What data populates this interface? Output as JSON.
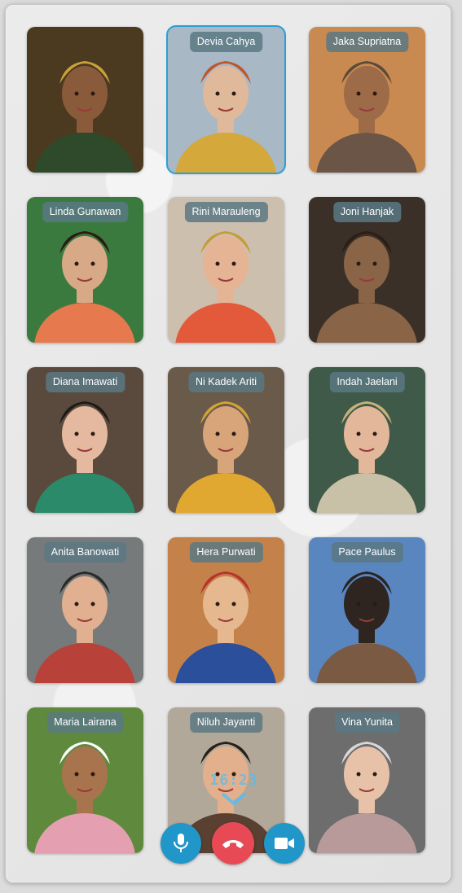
{
  "call": {
    "timer": "16:23",
    "participants": [
      {
        "name": "",
        "active": false,
        "bg": "#4b3a20",
        "skin": "#8a5b3a",
        "hat": "#c9a23a",
        "cloth": "#2e4a2b"
      },
      {
        "name": "Devia Cahya",
        "active": true,
        "bg": "#a8b8c4",
        "skin": "#e0b89a",
        "hat": "#c0552c",
        "cloth": "#d4a83a"
      },
      {
        "name": "Jaka Supriatna",
        "active": false,
        "bg": "#c88a50",
        "skin": "#9d6b48",
        "hat": "#5a4a3a",
        "cloth": "#6a5546"
      },
      {
        "name": "Linda Gunawan",
        "active": false,
        "bg": "#3b7a3e",
        "skin": "#d7a987",
        "hat": "#2b1b14",
        "cloth": "#e67a4e"
      },
      {
        "name": "Rini Marauleng",
        "active": false,
        "bg": "#cdbfae",
        "skin": "#e4b494",
        "hat": "#c99a38",
        "cloth": "#e25a3a"
      },
      {
        "name": "Joni Hanjak",
        "active": false,
        "bg": "#3a3028",
        "skin": "#8a6446",
        "hat": "#2a1e16",
        "cloth": "#8a6446"
      },
      {
        "name": "Diana Imawati",
        "active": false,
        "bg": "#5a4a3e",
        "skin": "#e5b9a0",
        "hat": "#1f1a18",
        "cloth": "#2a8a6a"
      },
      {
        "name": "Ni Kadek Ariti",
        "active": false,
        "bg": "#6a5a4a",
        "skin": "#d8a47a",
        "hat": "#d2a434",
        "cloth": "#e0a830"
      },
      {
        "name": "Indah Jaelani",
        "active": false,
        "bg": "#3f5a48",
        "skin": "#e3b89a",
        "hat": "#c7b27a",
        "cloth": "#c9c0a8"
      },
      {
        "name": "Anita Banowati",
        "active": false,
        "bg": "#777a7a",
        "skin": "#e0b090",
        "hat": "#2a2a2a",
        "cloth": "#b8423a"
      },
      {
        "name": "Hera Purwati",
        "active": false,
        "bg": "#c4824a",
        "skin": "#e6b890",
        "hat": "#b8322e",
        "cloth": "#2b4f9a"
      },
      {
        "name": "Pace Paulus",
        "active": false,
        "bg": "#5a86c0",
        "skin": "#2e2420",
        "hat": "#2b2520",
        "cloth": "#7a5a42"
      },
      {
        "name": "Maria Lairana",
        "active": false,
        "bg": "#5f8a3e",
        "skin": "#a8744e",
        "hat": "#ffffff",
        "cloth": "#e4a0b0"
      },
      {
        "name": "Niluh Jayanti",
        "active": false,
        "bg": "#b2a89a",
        "skin": "#e2b08c",
        "hat": "#2a1f1a",
        "cloth": "#5a4030"
      },
      {
        "name": "Vina Yunita",
        "active": false,
        "bg": "#6d6d6d",
        "skin": "#e8c2a8",
        "hat": "#d8d8d8",
        "cloth": "#b99a9a"
      }
    ]
  },
  "controls": {
    "mic_icon": "microphone-icon",
    "hangup_icon": "phone-hangup-icon",
    "camera_icon": "video-camera-icon",
    "primary_color": "#2196c9",
    "danger_color": "#e84a55"
  }
}
